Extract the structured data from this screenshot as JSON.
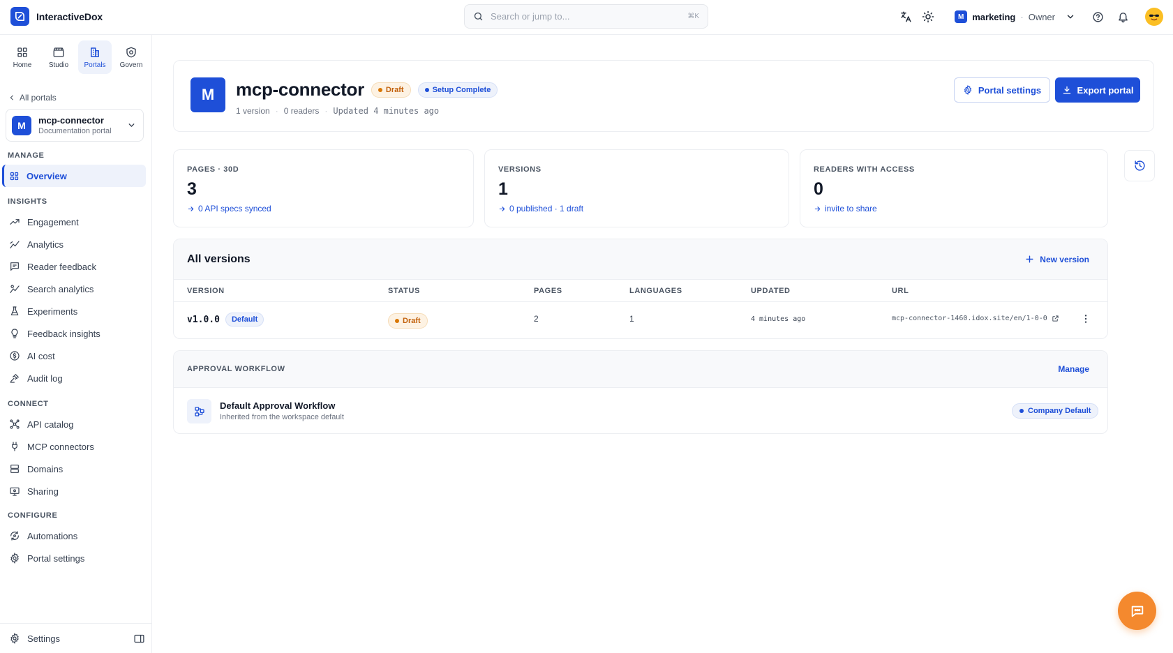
{
  "app": {
    "name": "InteractiveDox"
  },
  "search": {
    "placeholder": "Search or jump to...",
    "shortcut": "⌘K"
  },
  "workspace": {
    "badge": "M",
    "name": "marketing",
    "separator": "·",
    "role": "Owner"
  },
  "mode_tabs": [
    {
      "label": "Home",
      "icon": "grid-icon"
    },
    {
      "label": "Studio",
      "icon": "clapperboard-icon"
    },
    {
      "label": "Portals",
      "icon": "building-icon",
      "active": true
    },
    {
      "label": "Govern",
      "icon": "shield-icon"
    }
  ],
  "sidebar": {
    "back_label": "All portals",
    "portal": {
      "initial": "M",
      "name": "mcp-connector",
      "subtitle": "Documentation portal"
    },
    "sections": [
      {
        "title": "MANAGE",
        "items": [
          {
            "label": "Overview",
            "icon": "grid-icon",
            "active": true
          }
        ]
      },
      {
        "title": "INSIGHTS",
        "items": [
          {
            "label": "Engagement",
            "icon": "trend-icon"
          },
          {
            "label": "Analytics",
            "icon": "analytics-icon"
          },
          {
            "label": "Reader feedback",
            "icon": "message-icon"
          },
          {
            "label": "Search analytics",
            "icon": "search-analytics-icon"
          },
          {
            "label": "Experiments",
            "icon": "flask-icon"
          },
          {
            "label": "Feedback insights",
            "icon": "lightbulb-icon"
          },
          {
            "label": "AI cost",
            "icon": "dollar-icon"
          },
          {
            "label": "Audit log",
            "icon": "gavel-icon"
          }
        ]
      },
      {
        "title": "CONNECT",
        "items": [
          {
            "label": "API catalog",
            "icon": "network-icon"
          },
          {
            "label": "MCP connectors",
            "icon": "plug-icon"
          },
          {
            "label": "Domains",
            "icon": "server-icon"
          },
          {
            "label": "Sharing",
            "icon": "share-screen-icon"
          }
        ]
      },
      {
        "title": "CONFIGURE",
        "items": [
          {
            "label": "Automations",
            "icon": "automation-icon"
          },
          {
            "label": "Portal settings",
            "icon": "gear-icon"
          }
        ]
      }
    ],
    "settings_label": "Settings"
  },
  "header": {
    "initial": "M",
    "title": "mcp-connector",
    "status_draft": "Draft",
    "status_setup": "Setup Complete",
    "meta": [
      "1 version",
      "0 readers",
      "Updated 4 minutes ago"
    ],
    "meta_separator": "·",
    "settings_button": "Portal settings",
    "export_button": "Export portal"
  },
  "stats": [
    {
      "label": "PAGES · 30D",
      "value": "3",
      "link": "0 API specs synced"
    },
    {
      "label": "VERSIONS",
      "value": "1",
      "link": "0 published · 1 draft"
    },
    {
      "label": "READERS WITH ACCESS",
      "value": "0",
      "link": "invite to share"
    }
  ],
  "versions": {
    "title": "All versions",
    "new_button": "New version",
    "columns": [
      "VERSION",
      "STATUS",
      "PAGES",
      "LANGUAGES",
      "UPDATED",
      "URL"
    ],
    "rows": [
      {
        "version": "v1.0.0",
        "badge": "Default",
        "status": "Draft",
        "pages": "2",
        "languages": "1",
        "updated": "4 minutes ago",
        "url": "mcp-connector-1460.idox.site/en/1-0-0"
      }
    ]
  },
  "approval": {
    "title": "APPROVAL WORKFLOW",
    "manage_label": "Manage",
    "workflow_name": "Default Approval Workflow",
    "workflow_sub": "Inherited from the workspace default",
    "badge": "Company Default"
  },
  "colors": {
    "accent": "#1e4fd8",
    "draft": "#c2610c",
    "fab": "#f4892e"
  }
}
